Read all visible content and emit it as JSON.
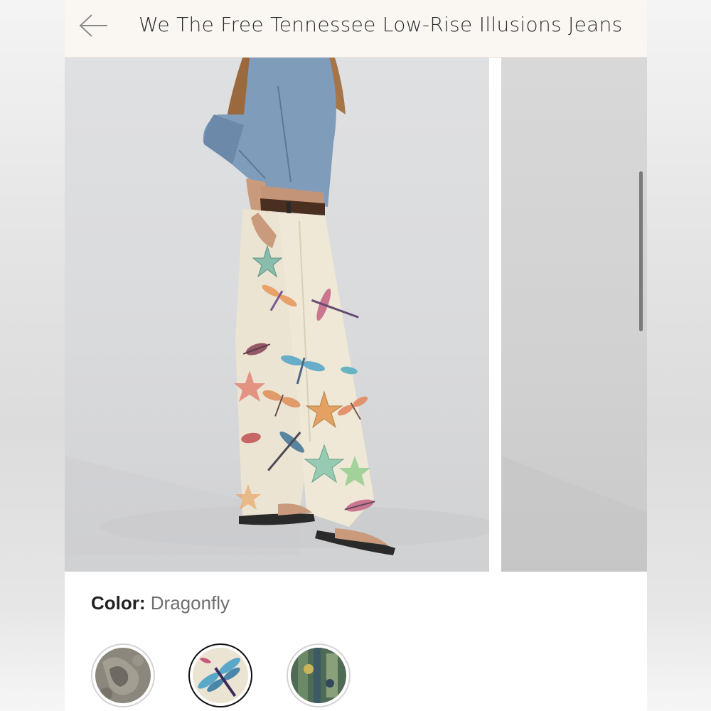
{
  "header": {
    "title": "We The Free Tennessee Low-Rise Illusions Jeans",
    "back_icon": "arrow-left-icon"
  },
  "gallery": {
    "active_image": 1,
    "image_count_visible": 2
  },
  "color_selector": {
    "label": "Color:",
    "selected": "Dragonfly",
    "swatches": [
      {
        "name": "paisley-swatch"
      },
      {
        "name": "dragonfly-swatch",
        "selected": true
      },
      {
        "name": "green-print-swatch"
      }
    ]
  },
  "colors": {
    "header_bg": "#faf7f3",
    "denim": "#7f9cbb",
    "jeans": "#ece4d2"
  }
}
